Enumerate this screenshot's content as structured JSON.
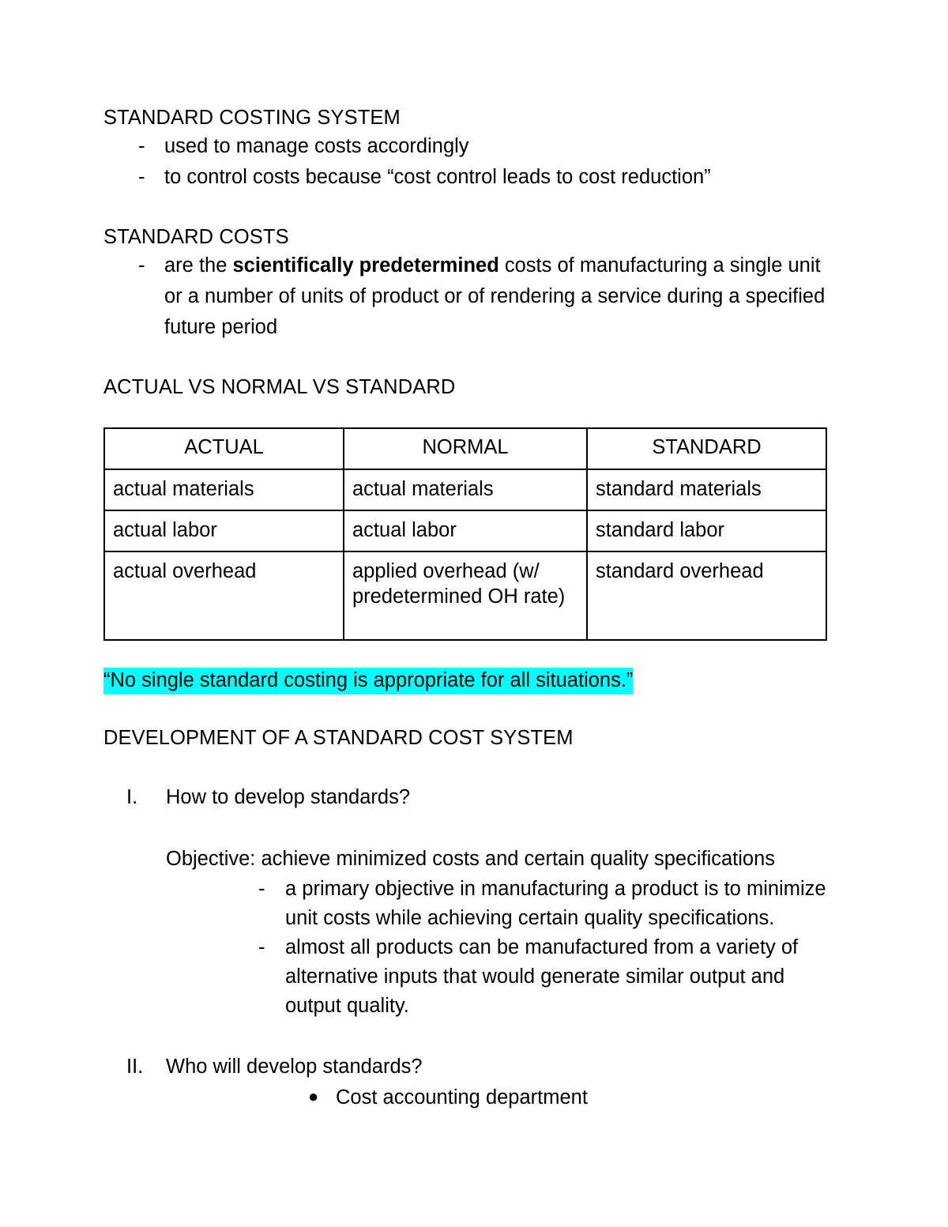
{
  "document": {
    "sections": {
      "standard_costing_system": {
        "heading": "STANDARD COSTING SYSTEM",
        "bullets": [
          "used to manage costs accordingly",
          "to control costs because “cost control leads to cost reduction”"
        ],
        "dash_mark": "-"
      },
      "standard_costs": {
        "heading": "STANDARD COSTS",
        "bullet_prefix": "are the ",
        "bullet_bold": "scientifically predetermined",
        "bullet_suffix": " costs of manufacturing a single unit or a number of units of product or of rendering a service during a specified future period",
        "dash_mark": "-"
      },
      "comparison": {
        "heading": "ACTUAL VS NORMAL VS STANDARD",
        "table": {
          "columns": [
            "ACTUAL",
            "NORMAL",
            "STANDARD"
          ],
          "rows": [
            [
              "actual materials",
              "actual materials",
              "standard materials"
            ],
            [
              "actual labor",
              "actual labor",
              "standard labor"
            ],
            [
              "actual overhead",
              "applied overhead (w/ predetermined OH rate)",
              "standard overhead"
            ]
          ]
        }
      },
      "quote": {
        "text": "“No single standard costing is appropriate for all situations.”",
        "highlight_color": "#00ffff"
      },
      "development": {
        "heading": "DEVELOPMENT OF A STANDARD COST SYSTEM",
        "items": [
          {
            "marker": "I.",
            "title": "How to develop standards?",
            "objective": "Objective: achieve minimized costs and certain quality specifications",
            "dash_mark": "-",
            "sub_bullets": [
              "a primary objective in manufacturing a product is to minimize unit costs while achieving certain quality specifications.",
              "almost all products can be manufactured from a variety of alternative inputs that would generate similar output and output quality."
            ]
          },
          {
            "marker": "II.",
            "title": "Who will develop standards?",
            "bullet_mark": "●",
            "bullets": [
              "Cost accounting department"
            ]
          }
        ]
      }
    }
  }
}
